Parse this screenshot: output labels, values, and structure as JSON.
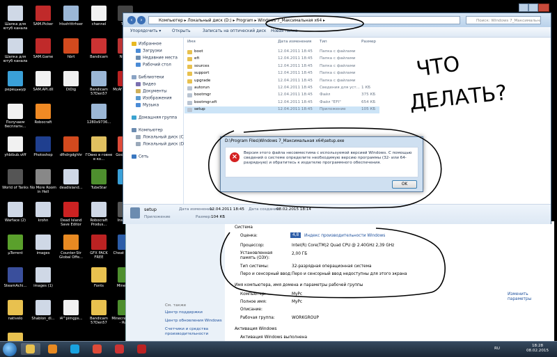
{
  "desktop_icons": [
    {
      "label": "Шапка для ютуб канала",
      "color": "#cfd8e6"
    },
    {
      "label": "SAM.Picker",
      "color": "#c02a2a"
    },
    {
      "label": "htsxhtttrhser",
      "color": "#9bb7d6"
    },
    {
      "label": "channel",
      "color": "#f1f1f1"
    },
    {
      "label": "Tunn",
      "color": "#444"
    },
    {
      "label": "Шапка для ютуб канала",
      "color": "#cfd8e6"
    },
    {
      "label": "SAM.Game",
      "color": "#c02a2a"
    },
    {
      "label": "hbrt",
      "color": "#d24a1e"
    },
    {
      "label": "Bandicam",
      "color": "#c33"
    },
    {
      "label": "Neven",
      "color": "#b33"
    },
    {
      "label": "ререцьыур",
      "color": "#3aa0d8"
    },
    {
      "label": "SAM.API.dll",
      "color": "#f1f1f1"
    },
    {
      "label": "DiDig",
      "color": "#f1f1f1"
    },
    {
      "label": "Bandicam 57Den57",
      "color": "#9bb7d6"
    },
    {
      "label": "McAf Security",
      "color": "#b22"
    },
    {
      "label": "Получаем бесплатн...",
      "color": "#f1f1f1"
    },
    {
      "label": "Robocraft",
      "color": "#f08a24"
    },
    {
      "label": "",
      "color": "#000"
    },
    {
      "label": "1280x9736...",
      "color": "#9bb7d6"
    },
    {
      "label": "",
      "color": "#000"
    },
    {
      "label": "yhbibub.vtff",
      "color": "#f1f1f1"
    },
    {
      "label": "Photoshop",
      "color": "#1f3f8f"
    },
    {
      "label": "dfhdrgdghhr",
      "color": "#d24a1e"
    },
    {
      "label": "ГОвно в говне в ко...",
      "color": "#e0c060"
    },
    {
      "label": "Goog Chro",
      "color": "#dd4b39"
    },
    {
      "label": "World of Tanks",
      "color": "#555"
    },
    {
      "label": "No More Room in Hell",
      "color": "#888"
    },
    {
      "label": "deadisland...",
      "color": "#cfd8e6"
    },
    {
      "label": "TubeStar",
      "color": "#4e8f2e"
    },
    {
      "label": "Ani",
      "color": "#3aa0d8"
    },
    {
      "label": "Warface (2)",
      "color": "#cfd8e6"
    },
    {
      "label": "krohn",
      "color": "#cfd8e6"
    },
    {
      "label": "Dead Island Save Editor",
      "color": "#c22"
    },
    {
      "label": "Robocraft Produs...",
      "color": "#cfd8e6"
    },
    {
      "label": "Insurgen",
      "color": "#555"
    },
    {
      "label": "µTorrent",
      "color": "#5aa02c"
    },
    {
      "label": "images",
      "color": "#cfd8e6"
    },
    {
      "label": "Counter-Str Global Offe...",
      "color": "#e88a22"
    },
    {
      "label": "GFX PACK FREE",
      "color": "#b22"
    },
    {
      "label": "Cheat Engine",
      "color": "#2c5da8"
    },
    {
      "label": "SteamAchi...",
      "color": "#3a4f9c"
    },
    {
      "label": "images (1)",
      "color": "#cfd8e6"
    },
    {
      "label": "",
      "color": "#000"
    },
    {
      "label": "Fonts",
      "color": "#e8c14f"
    },
    {
      "label": "Minecraft",
      "color": "#4e8f2e"
    },
    {
      "label": "nativelo",
      "color": "#e8c14f"
    },
    {
      "label": "Shablon_dl...",
      "color": "#cfd8e6"
    },
    {
      "label": "i4^pimgps...",
      "color": "#f1f1f1"
    },
    {
      "label": "Bandicam 57Den57",
      "color": "#e8c14f"
    },
    {
      "label": "Minecraft 1.7.4 - Ru-...",
      "color": "#4e8f2e"
    },
    {
      "label": "game",
      "color": "#e8c14f"
    }
  ],
  "explorer": {
    "address_path": "Компьютер ▸ Локальный диск (D:) ▸ Program ▸ Windows 7_Максимальная x64 ▸",
    "search_placeholder": "Поиск: Windows 7_Максимальная x64",
    "toolbar": {
      "organize": "Упорядочить ▾",
      "open": "Открыть",
      "burn": "Записать на оптический диск",
      "new_folder": "Новая папка"
    },
    "nav": [
      {
        "label": "Избранное",
        "color": "#e8b923"
      },
      {
        "label": "Загрузки",
        "color": "#4a8bd6"
      },
      {
        "label": "Недавние места",
        "color": "#6c8cb0"
      },
      {
        "label": "Рабочий стол",
        "color": "#4a8bd6"
      },
      {
        "label": "Библиотеки",
        "color": "#8aa3c4"
      },
      {
        "label": "Видео",
        "color": "#7a6fb0"
      },
      {
        "label": "Документы",
        "color": "#cfb05a"
      },
      {
        "label": "Изображения",
        "color": "#5a9ad0"
      },
      {
        "label": "Музыка",
        "color": "#4a8bd6"
      },
      {
        "label": "Домашняя группа",
        "color": "#3ba3d0"
      },
      {
        "label": "Компьютер",
        "color": "#6c8cb0"
      },
      {
        "label": "Локальный диск (C",
        "color": "#9aa9ba"
      },
      {
        "label": "Локальный диск (D",
        "color": "#9aa9ba"
      },
      {
        "label": "Сеть",
        "color": "#3a78c0"
      }
    ],
    "columns": {
      "name": "Имя",
      "date": "Дата изменения",
      "type": "Тип",
      "size": "Размер"
    },
    "files": [
      {
        "name": "boot",
        "date": "12.04.2011 18:45",
        "type": "Папка с файлами",
        "size": ""
      },
      {
        "name": "efi",
        "date": "12.04.2011 18:45",
        "type": "Папка с файлами",
        "size": ""
      },
      {
        "name": "sources",
        "date": "12.04.2011 18:45",
        "type": "Папка с файлами",
        "size": ""
      },
      {
        "name": "support",
        "date": "12.04.2011 18:45",
        "type": "Папка с файлами",
        "size": ""
      },
      {
        "name": "upgrade",
        "date": "12.04.2011 18:45",
        "type": "Папка с файлами",
        "size": ""
      },
      {
        "name": "autorun",
        "date": "12.04.2011 18:45",
        "type": "Сведения для уст...",
        "size": "1 КБ"
      },
      {
        "name": "bootmgr",
        "date": "12.04.2011 18:45",
        "type": "Файл",
        "size": "375 КБ"
      },
      {
        "name": "bootmgr.efi",
        "date": "12.04.2011 18:45",
        "type": "Файл \"EFI\"",
        "size": "654 КБ"
      },
      {
        "name": "setup",
        "date": "12.04.2011 18:45",
        "type": "Приложение",
        "size": "105 КБ"
      }
    ],
    "details": {
      "name": "setup",
      "kind": "Приложение",
      "modified_label": "Дата изменения:",
      "modified": "12.04.2011 18:45",
      "size_label": "Размер:",
      "size": "104 КБ",
      "created_label": "Дата создания:",
      "created": "08.02.2015 18:14"
    }
  },
  "dialog": {
    "title": "D:\\Program Files\\Windows 7_Максимальная x64\\setup.exe",
    "message": "Версия этого файла несовместима с используемой версией Windows. С помощью сведений о системе определите необходимую версию программы (32- или 64-разрядную) и обратитесь к издателю программного обеспечения.",
    "ok": "OK"
  },
  "sysinfo": {
    "section_system": "Система",
    "rating_label": "Оценка:",
    "rating_value": "Индекс производительности Windows",
    "rating_badge": "4,8",
    "cpu_label": "Процессор:",
    "cpu_value": "Intel(R) Core(TM)2 Quad CPU       @ 2.40GHz   2,39 GHz",
    "ram_label": "Установленная память (ОЗУ):",
    "ram_value": "2,00 ГБ",
    "type_label": "Тип системы:",
    "type_value": "32-разрядная операционная система",
    "pen_label": "Перо и сенсорный ввод:",
    "pen_value": "Перо и сенсорный ввод недоступны для этого экрана",
    "section_name": "Имя компьютера, имя домена и параметры рабочей группы",
    "comp_label": "Компьютер:",
    "comp_value": "MyPc",
    "full_label": "Полное имя:",
    "full_value": "MyPc",
    "desc_label": "Описание:",
    "desc_value": "",
    "wg_label": "Рабочая группа:",
    "wg_value": "WORKGROUP",
    "change": "Изменить параметры",
    "section_act": "Активация Windows",
    "act_label": "Активация Windows выполнена",
    "see_also": "См. также",
    "link1": "Центр поддержки",
    "link2": "Центр обновления Windows",
    "link3": "Счетчики и средства производительности"
  },
  "taskbar": {
    "items": [
      {
        "name": "explorer",
        "color": "#e8c14f"
      },
      {
        "name": "media",
        "color": "#e88a22"
      },
      {
        "name": "skype",
        "color": "#19a2e0"
      },
      {
        "name": "chrome",
        "color": "#dd4b39"
      },
      {
        "name": "unknown",
        "color": "#c33"
      },
      {
        "name": "bandicam",
        "color": "#b22"
      }
    ],
    "lang": "RU",
    "time": "18:28",
    "date": "08.02.2015"
  },
  "annotation": {
    "line1": "ЧТО",
    "line2": "ДЕЛАТЬ?"
  },
  "colors": {
    "dialog_error": "#d42121",
    "link": "#1c4f9c",
    "folder": "#e8c14f"
  }
}
